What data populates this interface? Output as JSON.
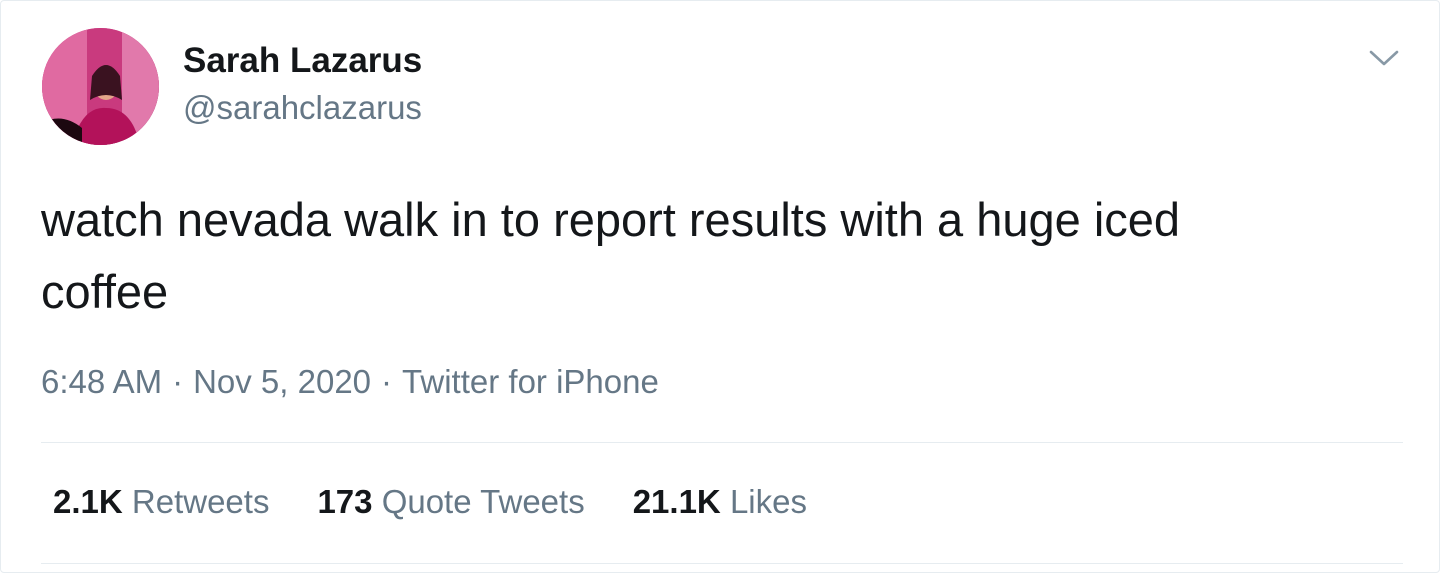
{
  "author": {
    "name": "Sarah Lazarus",
    "handle": "@sarahclazarus"
  },
  "tweet": {
    "text": "watch nevada walk in to report results with a huge iced\ncoffee"
  },
  "meta": {
    "time": "6:48 AM",
    "separator": "·",
    "date": "Nov 5, 2020",
    "source": "Twitter for iPhone"
  },
  "stats": {
    "retweets": {
      "count": "2.1K",
      "label": "Retweets"
    },
    "quotes": {
      "count": "173",
      "label": "Quote Tweets"
    },
    "likes": {
      "count": "21.1K",
      "label": "Likes"
    }
  },
  "icons": {
    "menu": "chevron-down-icon"
  },
  "colors": {
    "text_primary": "#14171a",
    "text_secondary": "#657786",
    "border": "#e6ecf0"
  }
}
